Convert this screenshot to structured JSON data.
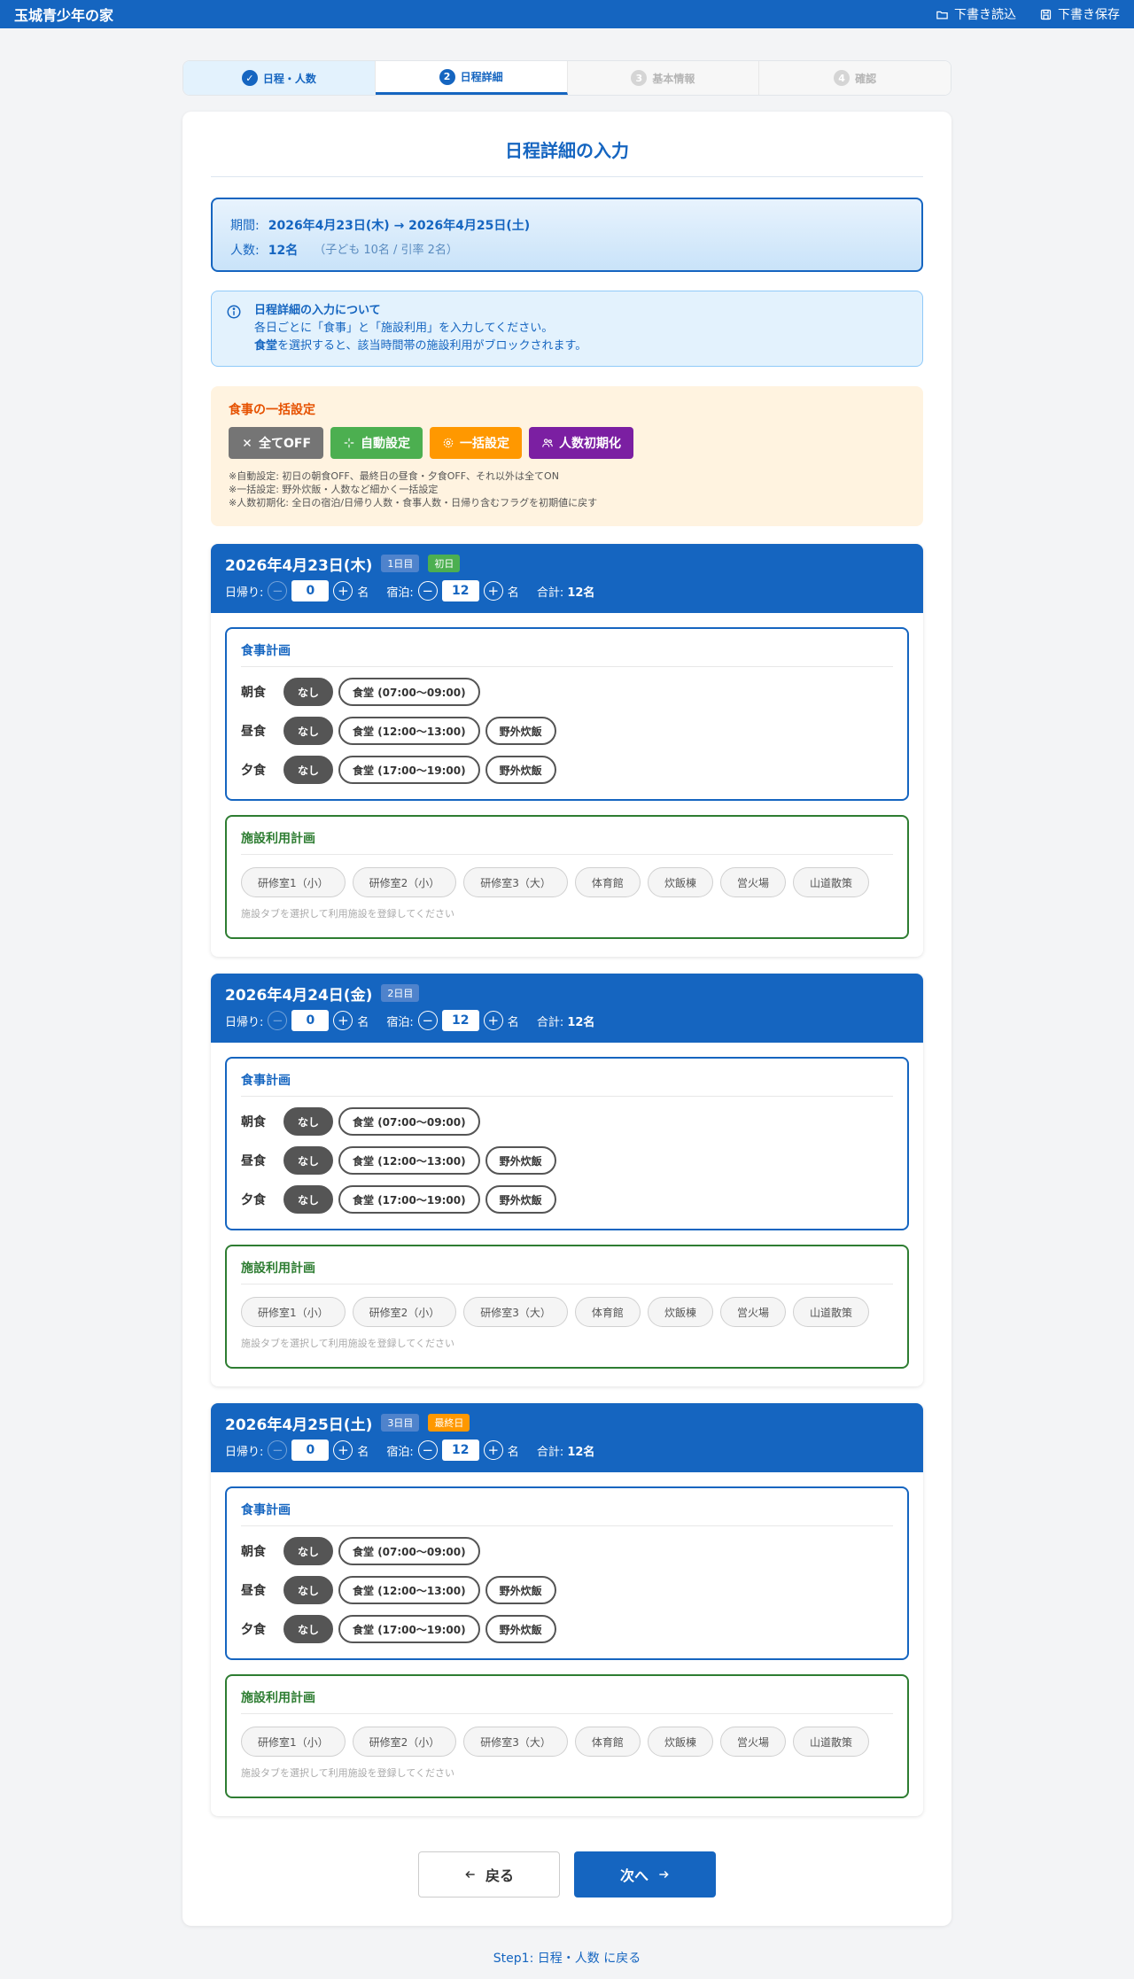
{
  "app": {
    "title": "玉城青少年の家",
    "load_draft": "下書き読込",
    "save_draft": "下書き保存"
  },
  "steps": [
    {
      "num": "✓",
      "label": "日程・人数"
    },
    {
      "num": "2",
      "label": "日程詳細"
    },
    {
      "num": "3",
      "label": "基本情報"
    },
    {
      "num": "4",
      "label": "確認"
    }
  ],
  "page_title": "日程詳細の入力",
  "period": {
    "label": "期間:",
    "value": "2026年4月23日(木) → 2026年4月25日(土)",
    "count_label": "人数:",
    "count_value": "12名",
    "count_sub": "（子ども 10名 / 引率 2名）"
  },
  "info": {
    "heading": "日程詳細の入力について",
    "line1": "各日ごとに「食事」と「施設利用」を入力してください。",
    "line2_bold": "食堂",
    "line2_rest": "を選択すると、該当時間帯の施設利用がブロックされます。"
  },
  "bulk": {
    "heading": "食事の一括設定",
    "buttons": {
      "all_off": "全てOFF",
      "auto": "自動設定",
      "bulk": "一括設定",
      "reset": "人数初期化"
    },
    "notes": [
      "※自動設定: 初日の朝食OFF、最終日の昼食・夕食OFF、それ以外は全てON",
      "※一括設定: 野外炊飯・人数など細かく一括設定",
      "※人数初期化: 全日の宿泊/日帰り人数・食事人数・日帰り含むフラグを初期値に戻す"
    ]
  },
  "labels": {
    "daytrip": "日帰り:",
    "stay": "宿泊:",
    "unit": "名",
    "total_label": "合計:",
    "meal_plan": "食事計画",
    "facility_plan": "施設利用計画",
    "facility_hint": "施設タブを選択して利用施設を登録してください",
    "breakfast": "朝食",
    "lunch": "昼食",
    "dinner": "夕食",
    "none": "なし",
    "breakfast_cafeteria": "食堂 (07:00〜09:00)",
    "lunch_cafeteria": "食堂 (12:00〜13:00)",
    "dinner_cafeteria": "食堂 (17:00〜19:00)",
    "outdoor": "野外炊飯"
  },
  "facilities": [
    "研修室1（小）",
    "研修室2（小）",
    "研修室3（大）",
    "体育館",
    "炊飯棟",
    "営火場",
    "山道散策"
  ],
  "days": [
    {
      "date": "2026年4月23日(木)",
      "nth": "1日目",
      "tag": "初日",
      "daytrip": "0",
      "stay": "12",
      "total": "12名"
    },
    {
      "date": "2026年4月24日(金)",
      "nth": "2日目",
      "tag": "",
      "daytrip": "0",
      "stay": "12",
      "total": "12名"
    },
    {
      "date": "2026年4月25日(土)",
      "nth": "3日目",
      "tag": "最終日",
      "daytrip": "0",
      "stay": "12",
      "total": "12名"
    }
  ],
  "nav": {
    "back": "戻る",
    "next": "次へ"
  },
  "footer_link": "Step1: 日程・人数 に戻る",
  "colors": {
    "primary": "#1565c0",
    "meal_border": "#1565c0",
    "facility_border": "#2e7d32",
    "bulk_bg": "#fff3e0"
  }
}
